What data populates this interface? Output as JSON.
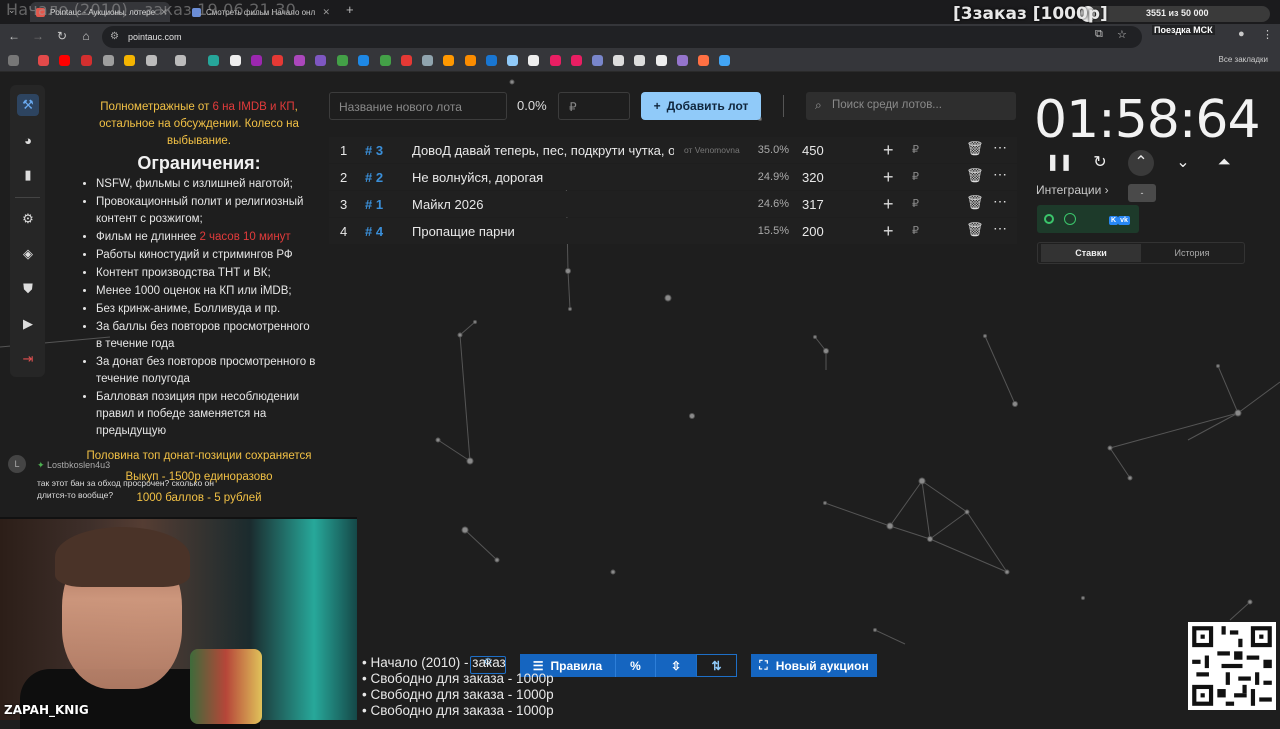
{
  "browser": {
    "tabs": [
      {
        "label": "Pointauc - Аукционы, лотере"
      },
      {
        "label": "Смотреть фильм Начало онл"
      }
    ],
    "url": "pointauc.com",
    "all_bookmarks": "Все закладки"
  },
  "stream_overlay": {
    "now_playing": "Начало (2010) - заказ 19.06 21.30",
    "order_banner": "[3заказ [1000р]",
    "progress_text": "3551  из 50 000",
    "progress_fraction": 0.071,
    "trip_label": "Поездка МСК",
    "streamer_name": "ZAPAH_KNIG",
    "queue": [
      "• Начало (2010) - заказ",
      "• Свободно для заказа - 1000р",
      "• Свободно для заказа - 1000р",
      "• Свободно для заказа - 1000р"
    ]
  },
  "rules": {
    "intro_a": "Полнометражные от ",
    "intro_red": "6 на IMDB и КП",
    "intro_b": ", остальное на обсуждении. Колесо на выбывание.",
    "title": "Ограничения:",
    "items": [
      "NSFW, фильмы с излишней наготой;",
      "Провокационный полит и религиозный контент с розжигом;",
      "Фильм не длиннее ",
      "Работы киностудий и стримингов РФ",
      "Контент производства ТНТ и ВК;",
      "Менее 1000 оценок на КП или iMDB;",
      "Без кринж-аниме, Болливуда и пр.",
      "За баллы без повторов просмотренного в течение года",
      "За донат без повторов просмотренного в течение полугода",
      "Балловая позиция при несоблюдении правил и победе заменяется на предыдущую"
    ],
    "length_red": "2 часов 10 минут",
    "footer1": "Половина топ донат-позиции сохраняется",
    "footer2": "Выкуп - 1500р единоразово",
    "footer3": "1000 баллов - 5 рублей"
  },
  "chat": {
    "avatar": "L",
    "user": "Lostbkoslen4u3",
    "message": "так этот бан за обход просрочен? сколько он длится-то вообще?"
  },
  "toolbar": {
    "lot_name_placeholder": "Название нового лота",
    "percent": "0.0%",
    "amount_placeholder": "₽",
    "add_button": "Добавить лот",
    "search_placeholder": "Поиск среди лотов..."
  },
  "lots": [
    {
      "n": "1",
      "id": "# 3",
      "name": "ДовоД давай теперь, пес, подкрути чутка, о",
      "from": "от Venomovna",
      "pct": "35.0%",
      "value": "450"
    },
    {
      "n": "2",
      "id": "# 2",
      "name": "Не волнуйся, дорогая",
      "from": "",
      "pct": "24.9%",
      "value": "320"
    },
    {
      "n": "3",
      "id": "# 1",
      "name": "Майкл 2026",
      "from": "",
      "pct": "24.6%",
      "value": "317"
    },
    {
      "n": "4",
      "id": "# 4",
      "name": "Пропащие парни",
      "from": "",
      "pct": "15.5%",
      "value": "200"
    }
  ],
  "lot_currency": "₽",
  "timer": {
    "display": "01:58:64",
    "tooltip": "-"
  },
  "integrations": {
    "label": "Интеграции",
    "vk_label": "K",
    "vk_badge": "vk"
  },
  "history_tabs": [
    {
      "label": "Ставки"
    },
    {
      "label": "История"
    }
  ],
  "bottom": {
    "rules_button": "Правила",
    "new_auction_button": "Новый аукцион"
  }
}
